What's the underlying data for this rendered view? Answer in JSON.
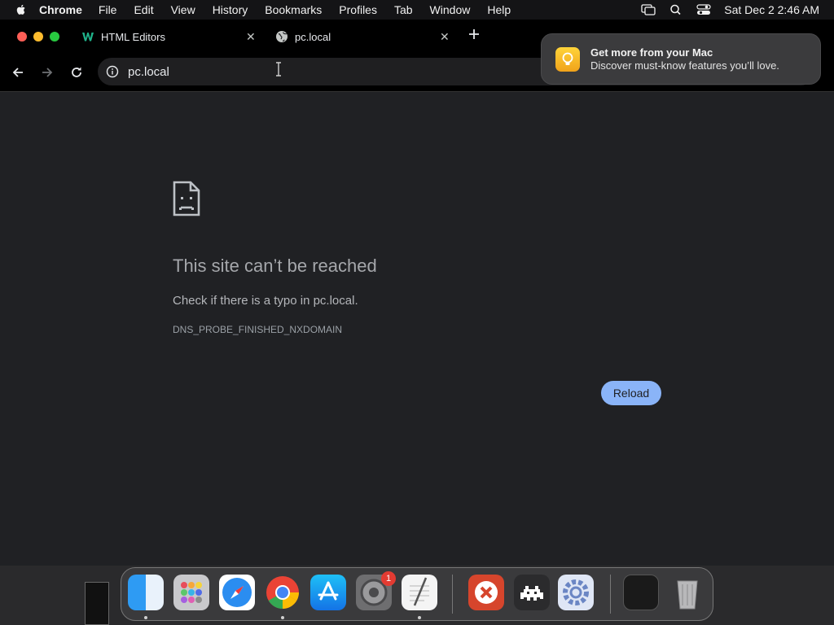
{
  "menubar": {
    "app_name": "Chrome",
    "items": [
      "File",
      "Edit",
      "View",
      "History",
      "Bookmarks",
      "Profiles",
      "Tab",
      "Window",
      "Help"
    ],
    "clock": "Sat Dec 2  2:46 AM"
  },
  "tabs": [
    {
      "title": "HTML Editors",
      "favicon": "w-logo-icon"
    },
    {
      "title": "pc.local",
      "favicon": "globe-icon"
    }
  ],
  "omnibox": {
    "url": "pc.local"
  },
  "notification": {
    "title": "Get more from your Mac",
    "body": "Discover must-know features you’ll love."
  },
  "error_page": {
    "title": "This site can’t be reached",
    "message": "Check if there is a typo in pc.local.",
    "code": "DNS_PROBE_FINISHED_NXDOMAIN",
    "reload_label": "Reload"
  },
  "dock": {
    "apps": [
      "Finder",
      "Launchpad",
      "Safari",
      "Google Chrome",
      "App Store",
      "System Settings",
      "TextEdit",
      "Remote Desktop",
      "Game Launcher",
      "Preferences"
    ],
    "settings_badge": "1"
  },
  "colors": {
    "page_bg": "#202124",
    "reload_button": "#8ab4f8",
    "badge": "#e33b32"
  }
}
